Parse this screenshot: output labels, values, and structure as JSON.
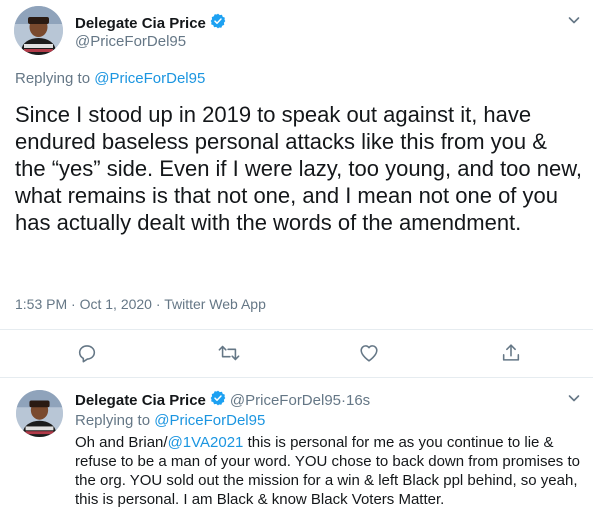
{
  "main": {
    "author": {
      "display_name": "Delegate Cia Price",
      "handle": "@PriceForDel95",
      "verified": true
    },
    "replying_prefix": "Replying to ",
    "replying_handle": "@PriceForDel95",
    "text": "Since I stood up in 2019 to speak out against it, have endured baseless personal attacks like this from you & the “yes” side. Even if I were lazy, too young, and too new, what remains is that not one, and I mean not one of you has actually dealt with the words of the amendment.",
    "time": "1:53 PM",
    "date": "Oct 1, 2020",
    "source": "Twitter Web App",
    "sep": " · "
  },
  "actions": {
    "reply_icon": "reply-icon",
    "retweet_icon": "retweet-icon",
    "like_icon": "heart-icon",
    "share_icon": "share-icon"
  },
  "reply": {
    "author": {
      "display_name": "Delegate Cia Price",
      "handle": "@PriceForDel95",
      "verified": true
    },
    "age": "16s",
    "sep": " · ",
    "replying_prefix": "Replying to ",
    "replying_handle": "@PriceForDel95",
    "text_before": "Oh and Brian/",
    "mention": "@1VA2021",
    "text_after": " this is personal for me as you continue to lie & refuse to be a man of your word. YOU chose to back down from promises to the org. YOU sold out the mission for a win & left Black ppl behind, so yeah, this is personal.  I am Black &  know Black Voters Matter."
  },
  "colors": {
    "accent": "#1b95e0",
    "secondary_text": "#657786",
    "divider": "#e6ecf0"
  }
}
